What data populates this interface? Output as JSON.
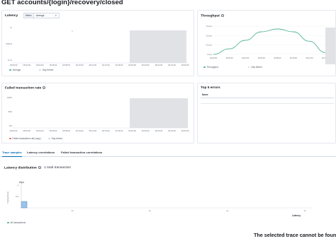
{
  "page": {
    "title": "GET accounts/{login}/recovery/closed"
  },
  "latency": {
    "title": "Latency",
    "metric_label": "Metric",
    "metric_value": "Average",
    "yticks": [
      "1s",
      "500ms",
      "0 ms"
    ],
    "xticks": [
      "18:00:00",
      "18:02:00",
      "18:04:00",
      "18:06:00",
      "18:08:00",
      "18:10:00",
      "18:12:00",
      "18:14:00",
      "18:16:00",
      "18:18:00",
      "18:20:00",
      "18:22:00",
      "18:24:00",
      "18:26:00"
    ],
    "legend": [
      "Average",
      "Day before"
    ],
    "colors": {
      "average": "#54b399",
      "day_before": "#d3dae6",
      "shade": "#e0e2e6"
    }
  },
  "throughput": {
    "title": "Throughput",
    "yticks": [
      "1.5 tpm",
      "1.0 tpm",
      "0.5 tpm",
      "0 tpm"
    ],
    "xticks": [
      "18:00:00",
      "18:02:00",
      "18:04:00",
      "18:06:00",
      "18:08:00",
      "18:10:00",
      "18:12:00",
      "18:14:00"
    ],
    "legend": [
      "Throughput",
      "Day before"
    ],
    "chart_data": {
      "type": "line",
      "x": [
        "18:00:00",
        "18:02:00",
        "18:04:00",
        "18:06:00",
        "18:08:00",
        "18:10:00",
        "18:12:00",
        "18:14:00"
      ],
      "series": [
        {
          "name": "Throughput",
          "values": [
            0.0,
            0.3,
            0.75,
            1.2,
            1.35,
            1.2,
            0.7,
            0.1
          ]
        }
      ],
      "ylim": [
        0,
        1.5
      ]
    }
  },
  "failed": {
    "title": "Failed transaction rate",
    "yticks": [
      "100%",
      "50%",
      "0%"
    ],
    "xticks": [
      "18:00:00",
      "18:02:00",
      "18:04:00",
      "18:06:00",
      "18:08:00",
      "18:10:00",
      "18:12:00",
      "18:14:00",
      "18:16:00",
      "18:18:00",
      "18:20:00",
      "18:22:00",
      "18:24:00",
      "18:26:00"
    ],
    "legend": [
      "Failed transaction rate (avg.)",
      "Day before"
    ]
  },
  "errors": {
    "title": "Top 5 errors",
    "column": "Name"
  },
  "tabs": [
    "Trace samples",
    "Latency correlations",
    "Failed transaction correlations"
  ],
  "distribution": {
    "title": "Latency distribution",
    "total": "1 total transaction",
    "ylabel": "Transactions",
    "xlabel": "Latency",
    "yticks": [
      "1",
      "0.5"
    ],
    "xticks": [
      "1s",
      "1s",
      "1s",
      "1s"
    ],
    "bar_label": "60µs",
    "legend": "All transactions",
    "chart_data": {
      "type": "bar",
      "categories": [
        "60µs"
      ],
      "values": [
        1
      ],
      "ylim": [
        0,
        1
      ]
    }
  },
  "empty_state": "The selected trace cannot be found"
}
